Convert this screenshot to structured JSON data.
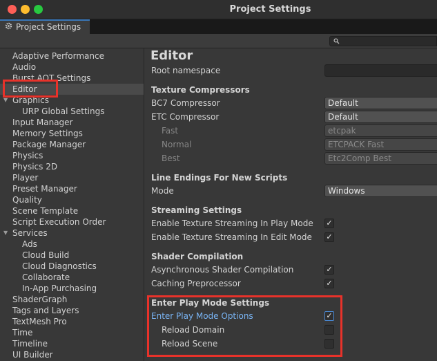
{
  "window": {
    "title": "Project Settings",
    "tab_label": "Project Settings"
  },
  "search": {
    "placeholder": ""
  },
  "sidebar": {
    "items": [
      {
        "label": "Adaptive Performance"
      },
      {
        "label": "Audio"
      },
      {
        "label": "Burst AOT Settings"
      },
      {
        "label": "Editor",
        "selected": true
      },
      {
        "label": "Graphics",
        "expanded": true
      },
      {
        "label": "URP Global Settings"
      },
      {
        "label": "Input Manager"
      },
      {
        "label": "Memory Settings"
      },
      {
        "label": "Package Manager"
      },
      {
        "label": "Physics"
      },
      {
        "label": "Physics 2D"
      },
      {
        "label": "Player"
      },
      {
        "label": "Preset Manager"
      },
      {
        "label": "Quality"
      },
      {
        "label": "Scene Template"
      },
      {
        "label": "Script Execution Order"
      },
      {
        "label": "Services",
        "expanded": true
      },
      {
        "label": "Ads"
      },
      {
        "label": "Cloud Build"
      },
      {
        "label": "Cloud Diagnostics"
      },
      {
        "label": "Collaborate"
      },
      {
        "label": "In-App Purchasing"
      },
      {
        "label": "ShaderGraph"
      },
      {
        "label": "Tags and Layers"
      },
      {
        "label": "TextMesh Pro"
      },
      {
        "label": "Time"
      },
      {
        "label": "Timeline"
      },
      {
        "label": "UI Builder"
      }
    ]
  },
  "editor": {
    "title": "Editor",
    "root_namespace": {
      "label": "Root namespace",
      "value": ""
    },
    "texture_compressors": {
      "header": "Texture Compressors",
      "bc7": {
        "label": "BC7 Compressor",
        "value": "Default"
      },
      "etc": {
        "label": "ETC Compressor",
        "value": "Default"
      },
      "fast": {
        "label": "Fast",
        "value": "etcpak"
      },
      "normal": {
        "label": "Normal",
        "value": "ETCPACK Fast"
      },
      "best": {
        "label": "Best",
        "value": "Etc2Comp Best"
      }
    },
    "line_endings": {
      "header": "Line Endings For New Scripts",
      "mode": {
        "label": "Mode",
        "value": "Windows"
      }
    },
    "streaming": {
      "header": "Streaming Settings",
      "play_mode": {
        "label": "Enable Texture Streaming In Play Mode",
        "checked": true
      },
      "edit_mode": {
        "label": "Enable Texture Streaming In Edit Mode",
        "checked": true
      }
    },
    "shader_compilation": {
      "header": "Shader Compilation",
      "async": {
        "label": "Asynchronous Shader Compilation",
        "checked": true
      },
      "caching": {
        "label": "Caching Preprocessor",
        "checked": true
      }
    },
    "play_mode_settings": {
      "header": "Enter Play Mode Settings",
      "options": {
        "label": "Enter Play Mode Options",
        "checked": true
      },
      "reload_domain": {
        "label": "Reload Domain",
        "checked": false
      },
      "reload_scene": {
        "label": "Reload Scene",
        "checked": false
      }
    }
  },
  "check_glyph": "✓",
  "colors": {
    "highlight_box": "#e8322a",
    "focus_blue": "#4a8ad6",
    "link_blue": "#7ab5f5"
  }
}
